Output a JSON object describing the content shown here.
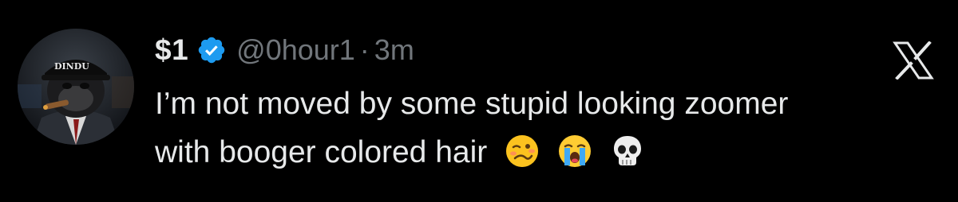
{
  "tweet": {
    "display_name": "$1",
    "handle": "@0hour1",
    "separator": "·",
    "time": "3m",
    "text_line1": "I’m not moved by some stupid looking zoomer",
    "text_line2": "with booger colored hair",
    "emojis": [
      "woozy-face",
      "loudly-crying-face",
      "skull"
    ],
    "avatar_cap_text": "DINDU"
  },
  "icons": {
    "verified": "verified-badge-icon",
    "platform": "x-logo-icon"
  },
  "colors": {
    "background": "#000000",
    "text": "#e7e9ea",
    "secondary": "#71767b",
    "verified": "#1d9bf0"
  }
}
